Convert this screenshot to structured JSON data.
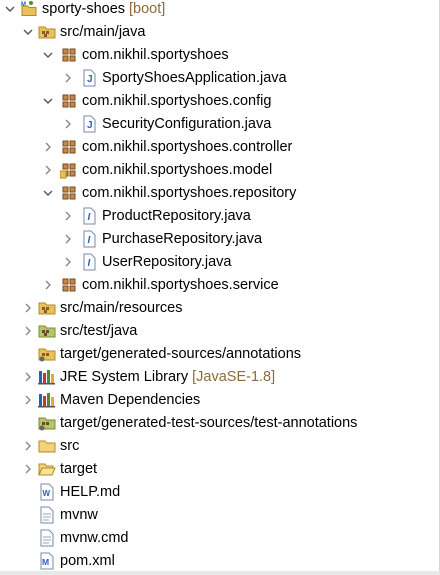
{
  "tree": {
    "items": [
      {
        "label": "sporty-shoes",
        "decoration": "[boot]",
        "icon": "maven-project-icon",
        "twisty": "expanded"
      },
      {
        "label": "src/main/java",
        "icon": "source-folder-icon",
        "twisty": "expanded"
      },
      {
        "label": "com.nikhil.sportyshoes",
        "icon": "package-icon",
        "twisty": "expanded"
      },
      {
        "label": "SportyShoesApplication.java",
        "icon": "java-class-file-icon",
        "twisty": "collapsed"
      },
      {
        "label": "com.nikhil.sportyshoes.config",
        "icon": "package-icon",
        "twisty": "expanded"
      },
      {
        "label": "SecurityConfiguration.java",
        "icon": "java-class-file-icon",
        "twisty": "collapsed"
      },
      {
        "label": "com.nikhil.sportyshoes.controller",
        "icon": "package-icon",
        "twisty": "collapsed"
      },
      {
        "label": "com.nikhil.sportyshoes.model",
        "icon": "package-decorated-icon",
        "twisty": "collapsed"
      },
      {
        "label": "com.nikhil.sportyshoes.repository",
        "icon": "package-icon",
        "twisty": "expanded"
      },
      {
        "label": "ProductRepository.java",
        "icon": "java-interface-file-icon",
        "twisty": "collapsed"
      },
      {
        "label": "PurchaseRepository.java",
        "icon": "java-interface-file-icon",
        "twisty": "collapsed"
      },
      {
        "label": "UserRepository.java",
        "icon": "java-interface-file-icon",
        "twisty": "collapsed"
      },
      {
        "label": "com.nikhil.sportyshoes.service",
        "icon": "package-icon",
        "twisty": "collapsed"
      },
      {
        "label": "src/main/resources",
        "icon": "source-folder-icon",
        "twisty": "collapsed"
      },
      {
        "label": "src/test/java",
        "icon": "test-source-folder-icon",
        "twisty": "collapsed"
      },
      {
        "label": "target/generated-sources/annotations",
        "icon": "generated-source-folder-icon",
        "twisty": "none"
      },
      {
        "label": "JRE System Library",
        "decoration": "[JavaSE-1.8]",
        "icon": "library-icon",
        "twisty": "collapsed"
      },
      {
        "label": "Maven Dependencies",
        "icon": "library-icon",
        "twisty": "collapsed"
      },
      {
        "label": "target/generated-test-sources/test-annotations",
        "icon": "generated-test-source-folder-icon",
        "twisty": "none"
      },
      {
        "label": "src",
        "icon": "folder-icon",
        "twisty": "collapsed"
      },
      {
        "label": "target",
        "icon": "folder-open-icon",
        "twisty": "collapsed"
      },
      {
        "label": "HELP.md",
        "icon": "markdown-file-icon",
        "twisty": "none"
      },
      {
        "label": "mvnw",
        "icon": "text-file-icon",
        "twisty": "none"
      },
      {
        "label": "mvnw.cmd",
        "icon": "text-file-icon",
        "twisty": "none"
      },
      {
        "label": "pom.xml",
        "icon": "maven-pom-icon",
        "twisty": "none"
      }
    ]
  },
  "colors": {
    "decoration": "#8a6d3b",
    "package": "#a0522d",
    "folder": "#e8c15a",
    "java_blue": "#2b5fb3"
  }
}
